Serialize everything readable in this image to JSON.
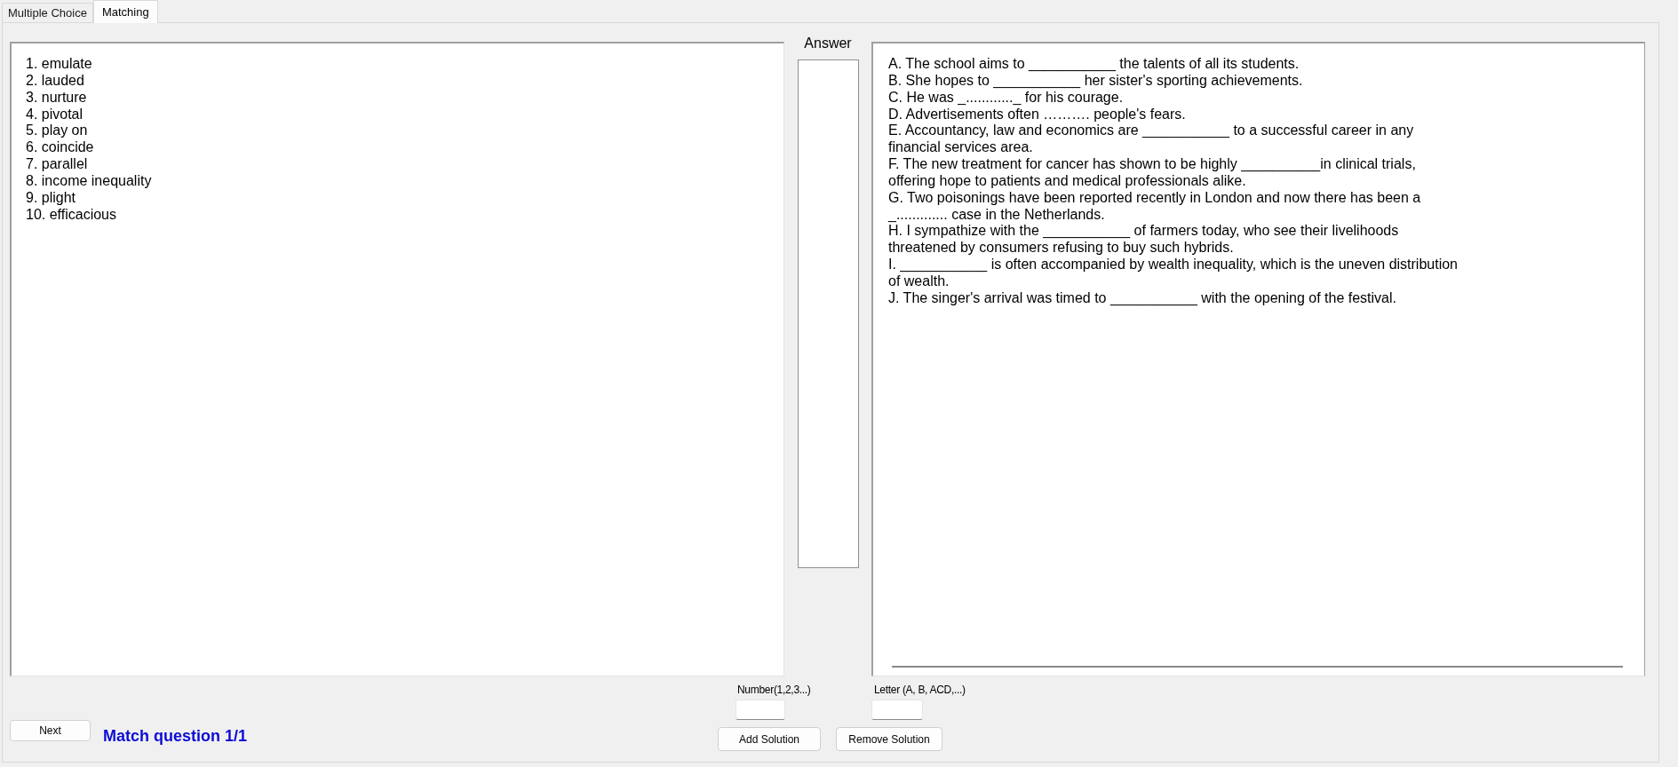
{
  "tabs": [
    {
      "label": "Multiple Choice",
      "selected": false
    },
    {
      "label": "Matching",
      "selected": true
    }
  ],
  "words": [
    "1. emulate",
    "2. lauded",
    "3. nurture",
    "4. pivotal",
    "5. play on",
    "6. coincide",
    "7. parallel",
    "8. income inequality",
    "9. plight",
    "10. efficacious"
  ],
  "answer": {
    "label": "Answer"
  },
  "sentences": [
    "A. The school aims to ___________ the talents of all its students.",
    "B. She hopes to ___________ her sister's sporting achievements.",
    "C. He was _............_ for his courage.",
    "D. Advertisements often ………. people's fears.",
    "E. Accountancy, law and economics are ___________ to a successful career in any\nfinancial services area.",
    "F. The new treatment for cancer has shown to be highly __________in clinical trials,\noffering hope to patients and medical professionals alike.",
    "G. Two poisonings have been reported recently in London and now there has been a\n_............. case in the Netherlands.",
    "H. I sympathize with the ___________ of farmers today, who see their livelihoods\nthreatened by consumers refusing to buy such hybrids.",
    "I. ___________ is often accompanied by wealth inequality, which is the uneven distribution\nof wealth.",
    "J. The singer's arrival was timed to ___________ with the opening of the festival."
  ],
  "next_button": {
    "label": "Next"
  },
  "status": "Match question 1/1",
  "solution_fields": [
    {
      "label": "Number(1,2,3...)"
    },
    {
      "label": "Letter (A, B, ACD,...)"
    }
  ],
  "buttons": [
    {
      "label": "Add Solution"
    },
    {
      "label": "Remove Solution"
    }
  ]
}
